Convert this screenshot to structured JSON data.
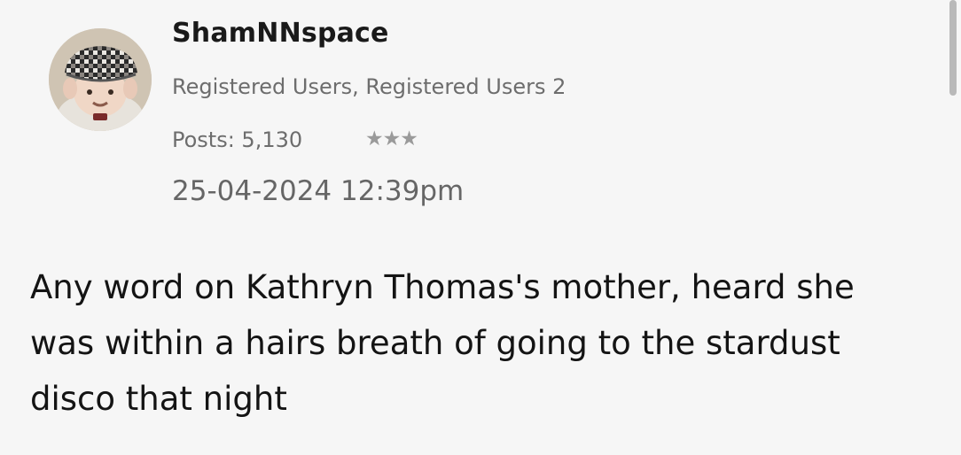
{
  "post": {
    "author": {
      "username": "ShamNNspace",
      "roles": "Registered Users, Registered Users 2",
      "posts_label": "Posts: 5,130",
      "rank_stars": "★★★",
      "avatar_icon": "user-avatar-flat-cap-icon"
    },
    "timestamp": "25-04-2024 12:39pm",
    "body": "Any word on Kathryn Thomas's mother, heard she was within a hairs breath of going to the stardust disco that night"
  },
  "colors": {
    "background": "#f6f6f6",
    "username": "#1a1a1a",
    "meta_text": "#6d6d6d",
    "body_text": "#141414",
    "scrollbar": "#b9b9b9"
  }
}
